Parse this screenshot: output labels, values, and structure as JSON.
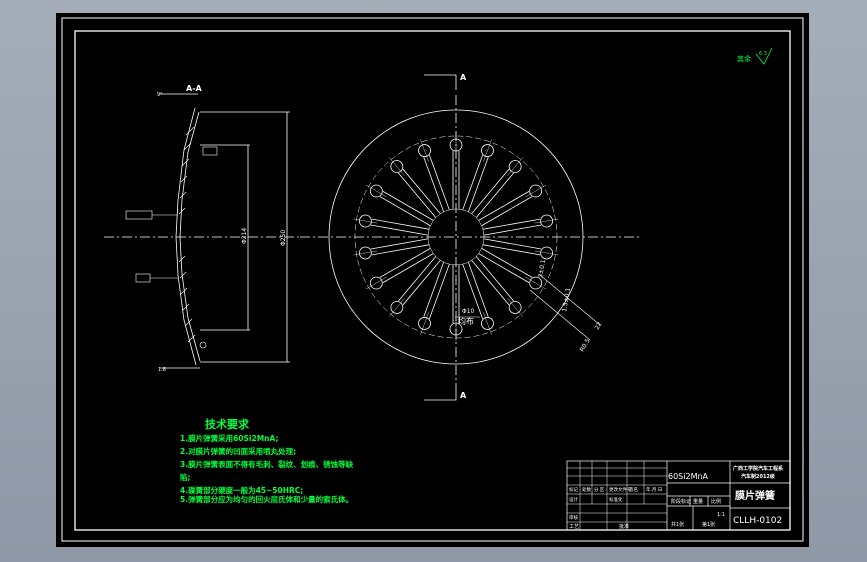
{
  "drawing": {
    "section_label": "A-A",
    "cut_label_top": "A",
    "cut_label_bottom": "A",
    "view_label_mid": "A",
    "slot_note": "均布",
    "roughness_note": "其余",
    "roughness_value": "6.3",
    "dim_outer_dia": "Φ250",
    "dim_inner_dia": "Φ214",
    "dim_hole": "Φ10",
    "dim_slot": "3±0.1",
    "dim_bend": "R0.5",
    "dim_offset": "1.5±0.1",
    "dim_small": "22",
    "dim_thick": "1.8",
    "dim_angle": "9°"
  },
  "tech": {
    "title": "技术要求",
    "lines": [
      "1.膜片弹簧采用60Si2MnA;",
      "2.对膜片弹簧的凹面采用喷丸处理;",
      "3.膜片弹簧表面不得有毛刺、裂纹、划痕、锈蚀等缺",
      "陷;",
      "4.碟簧部分硬度一般为45~50HRC;",
      "5.弹簧部分应为均匀的回火屈氏体和少量的索氏体。"
    ]
  },
  "title_block": {
    "material": "60Si2MnA",
    "school_line1": "广西工学院汽车工程系",
    "school_line2": "汽车制2012级",
    "part_name": "膜片弹簧",
    "drawing_no": "CLLH-0102",
    "stage_label": "阶段标记",
    "weight_label": "重量",
    "scale_label": "比例",
    "scale_value": "1:1",
    "sheet_total": "共1张",
    "sheet_no": "第1张",
    "row_labels": [
      "标记",
      "处数",
      "分 区",
      "更改文件号",
      "签名",
      "年.月.日"
    ],
    "row2": [
      "设计",
      "",
      "标准化",
      ""
    ],
    "row3": [
      "审核"
    ],
    "row4": [
      "工艺",
      "",
      "批准"
    ]
  },
  "colors": {
    "background": "#000000",
    "frame": "#ffffff",
    "text_green": "#00ff3c",
    "line_white": "#ffffff"
  }
}
